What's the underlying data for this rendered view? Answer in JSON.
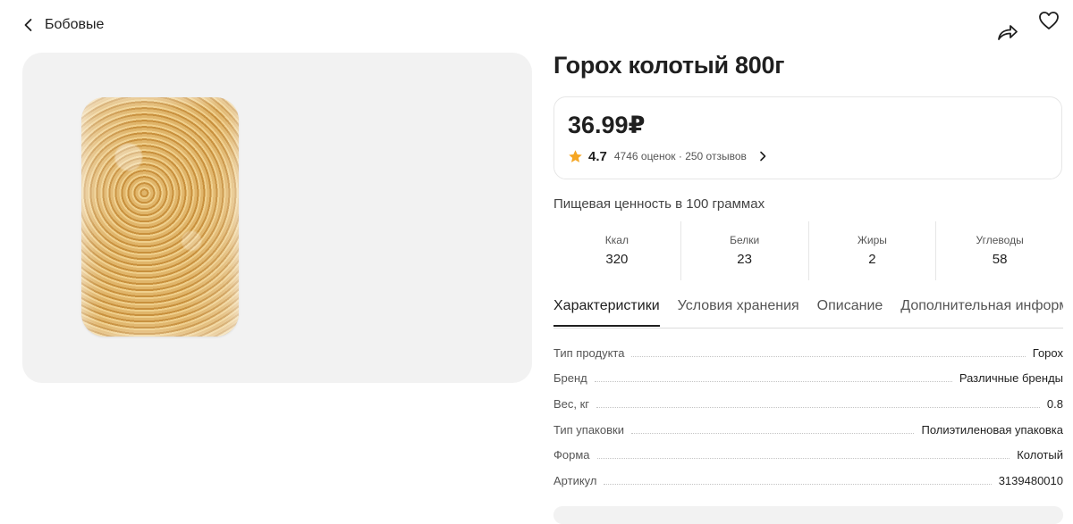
{
  "nav": {
    "back_label": "Бобовые"
  },
  "product": {
    "title": "Горох колотый 800г",
    "price": "36.99₽",
    "rating": "4.7",
    "reviews_summary": "4746 оценок · 250 отзывов"
  },
  "nutrition": {
    "title": "Пищевая ценность в 100 граммах",
    "items": [
      {
        "label": "Ккал",
        "value": "320"
      },
      {
        "label": "Белки",
        "value": "23"
      },
      {
        "label": "Жиры",
        "value": "2"
      },
      {
        "label": "Углеводы",
        "value": "58"
      }
    ]
  },
  "tabs": [
    {
      "label": "Характеристики",
      "active": true
    },
    {
      "label": "Условия хранения",
      "active": false
    },
    {
      "label": "Описание",
      "active": false
    },
    {
      "label": "Дополнительная информация",
      "active": false
    }
  ],
  "specs": [
    {
      "label": "Тип продукта",
      "value": "Горох"
    },
    {
      "label": "Бренд",
      "value": "Различные бренды"
    },
    {
      "label": "Вес, кг",
      "value": "0.8"
    },
    {
      "label": "Тип упаковки",
      "value": "Полиэтиленовая упаковка"
    },
    {
      "label": "Форма",
      "value": "Колотый"
    },
    {
      "label": "Артикул",
      "value": "3139480010"
    }
  ],
  "colors": {
    "star": "#f5a623",
    "text": "#1f1f1f",
    "card_bg": "#f2f2f2"
  },
  "icons": {
    "back": "chevron-left-icon",
    "share": "share-icon",
    "favorite": "heart-icon",
    "star": "star-icon",
    "reviews_arrow": "chevron-right-icon"
  }
}
